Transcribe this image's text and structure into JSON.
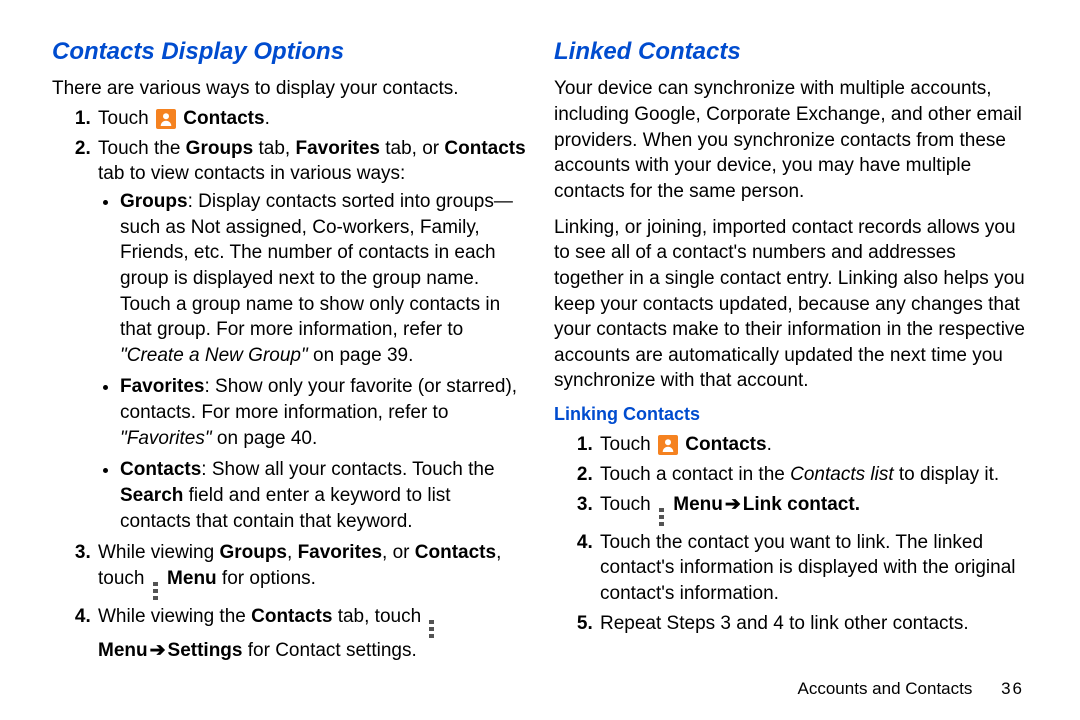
{
  "left": {
    "heading": "Contacts Display Options",
    "intro": "There are various ways to display your contacts.",
    "step1_a": "Touch ",
    "step1_b": "Contacts",
    "step1_c": ".",
    "step2_a": "Touch the ",
    "step2_b": "Groups",
    "step2_c": " tab, ",
    "step2_d": "Favorites",
    "step2_e": " tab, or ",
    "step2_f": "Contacts",
    "step2_g": " tab to view contacts in various ways:",
    "b1_a": "Groups",
    "b1_b": ": Display contacts sorted into groups—such as Not assigned, Co-workers, Family, Friends, etc. The number of contacts in each group is displayed next to the group name. Touch a group name to show only contacts in that group. For more information, refer to ",
    "b1_c": "\"Create a New Group\"",
    "b1_d": " on page 39.",
    "b2_a": "Favorites",
    "b2_b": ": Show only your favorite (or starred), contacts. For more information, refer to ",
    "b2_c": "\"Favorites\"",
    "b2_d": " on page 40.",
    "b3_a": "Contacts",
    "b3_b": ": Show all your contacts. Touch the ",
    "b3_c": "Search",
    "b3_d": " field and enter a keyword to list contacts that contain that keyword.",
    "step3_a": "While viewing ",
    "step3_b": "Groups",
    "step3_c": ", ",
    "step3_d": "Favorites",
    "step3_e": ", or ",
    "step3_f": "Contacts",
    "step3_g": ", touch ",
    "step3_h": "Menu",
    "step3_i": " for options.",
    "step4_a": "While viewing the ",
    "step4_b": "Contacts",
    "step4_c": " tab, touch ",
    "step4_d": "Menu",
    "step4_e": " ",
    "step4_f": "Settings",
    "step4_g": " for Contact settings."
  },
  "right": {
    "heading": "Linked Contacts",
    "p1": "Your device can synchronize with multiple accounts, including Google, Corporate Exchange, and other email providers. When you synchronize contacts from these accounts with your device, you may have multiple contacts for the same person.",
    "p2": "Linking, or joining, imported contact records allows you to see all of a contact's numbers and addresses together in a single contact entry. Linking also helps you keep your contacts updated, because any changes that your contacts make to their information in the respective accounts are automatically updated the next time you synchronize with that account.",
    "sub": "Linking Contacts",
    "s1_a": "Touch ",
    "s1_b": "Contacts",
    "s1_c": ".",
    "s2_a": "Touch a contact in the ",
    "s2_b": "Contacts list",
    "s2_c": " to display it.",
    "s3_a": "Touch ",
    "s3_b": "Menu",
    "s3_c": " ",
    "s3_d": "Link contact.",
    "s4": "Touch the contact you want to link. The linked contact's information is displayed with the original contact's information.",
    "s5": "Repeat Steps 3 and 4 to link other contacts."
  },
  "footer": {
    "section": "Accounts and Contacts",
    "page": "36"
  },
  "arrow": "➔"
}
